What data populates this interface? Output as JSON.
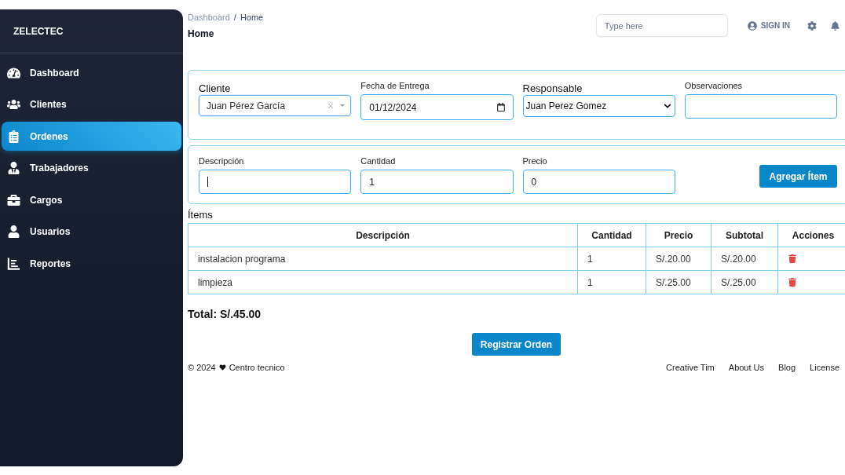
{
  "sidebar": {
    "brand": "ZELECTEC",
    "items": [
      {
        "label": "Dashboard",
        "selected": false
      },
      {
        "label": "Clientes",
        "selected": false
      },
      {
        "label": "Ordenes",
        "selected": true
      },
      {
        "label": "Trabajadores",
        "selected": false
      },
      {
        "label": "Cargos",
        "selected": false
      },
      {
        "label": "Usuarios",
        "selected": false
      },
      {
        "label": "Reportes",
        "selected": false
      }
    ]
  },
  "header": {
    "breadcrumb": {
      "items": [
        "Dashboard",
        "Home"
      ],
      "separator": "/"
    },
    "title": "Home",
    "search": {
      "placeholder": "Type here"
    },
    "sign_in": "SIGN IN"
  },
  "order_form": {
    "fields": [
      {
        "kind": "combobox",
        "label": "Cliente",
        "value": "Juan Pérez García"
      },
      {
        "kind": "date",
        "label": "Fecha de Entrega",
        "value": "01/12/2024"
      },
      {
        "kind": "select",
        "label": "Responsable",
        "value": "Juan Perez Gomez"
      },
      {
        "kind": "text",
        "label": "Observaciones",
        "focused": false
      }
    ]
  },
  "item_form": {
    "fields": [
      {
        "kind": "text",
        "label": "Descripción",
        "focused": true
      },
      {
        "kind": "text",
        "label": "Cantidad",
        "value": "1",
        "focused": false
      },
      {
        "kind": "text",
        "label": "Precio",
        "value": "0",
        "focused": false
      }
    ],
    "button": "Agregar Ítem"
  },
  "items": {
    "title": "Ítems",
    "columns": [
      "Descripción",
      "Cantidad",
      "Precio",
      "Subtotal",
      "Acciones"
    ],
    "rows": [
      [
        "instalacion programa",
        "1",
        "S/.20.00",
        "S/.20.00"
      ],
      [
        "limpieza",
        "1",
        "S/.25.00",
        "S/.25.00"
      ]
    ]
  },
  "total": "Total: S/.45.00",
  "submit": "Registrar Orden",
  "footer": {
    "copyright": "© 2024",
    "credit": "Centro tecnico",
    "links": [
      "Creative Tim",
      "About Us",
      "Blog",
      "License"
    ]
  }
}
